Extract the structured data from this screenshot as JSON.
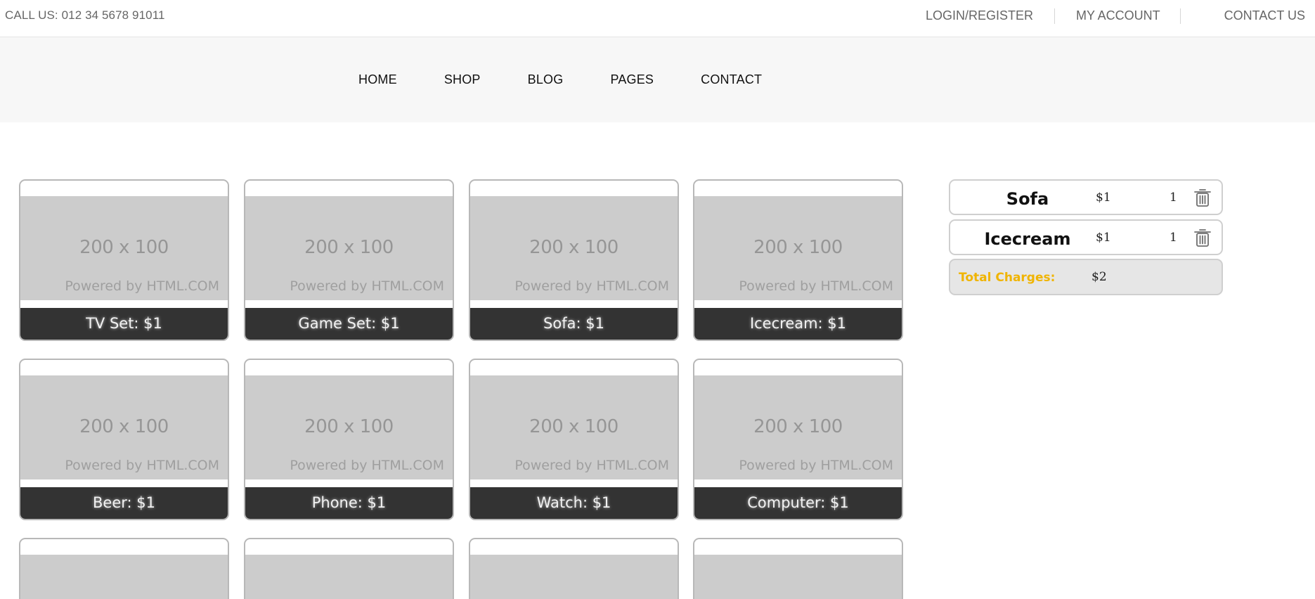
{
  "topbar": {
    "call": "CALL US: 012 34 5678 91011",
    "links": [
      "LOGIN/REGISTER",
      "MY ACCOUNT",
      "CONTACT US"
    ]
  },
  "nav": {
    "items": [
      "HOME",
      "SHOP",
      "BLOG",
      "PAGES",
      "CONTACT"
    ]
  },
  "placeholder": {
    "dimensions": "200 x 100",
    "powered": "Powered by HTML.COM"
  },
  "products": [
    {
      "label": "TV Set: $1"
    },
    {
      "label": "Game Set: $1"
    },
    {
      "label": "Sofa: $1"
    },
    {
      "label": "Icecream: $1"
    },
    {
      "label": "Beer: $1"
    },
    {
      "label": "Phone: $1"
    },
    {
      "label": "Watch: $1"
    },
    {
      "label": "Computer: $1"
    }
  ],
  "cart": {
    "items": [
      {
        "name": "Sofa",
        "price": "$1",
        "qty": "1",
        "icon": "trash-icon"
      },
      {
        "name": "Icecream",
        "price": "$1",
        "qty": "1",
        "icon": "trash-icon"
      }
    ],
    "total_label": "Total Charges:",
    "total_value": "$2",
    "accent_color": "#f0b400"
  }
}
